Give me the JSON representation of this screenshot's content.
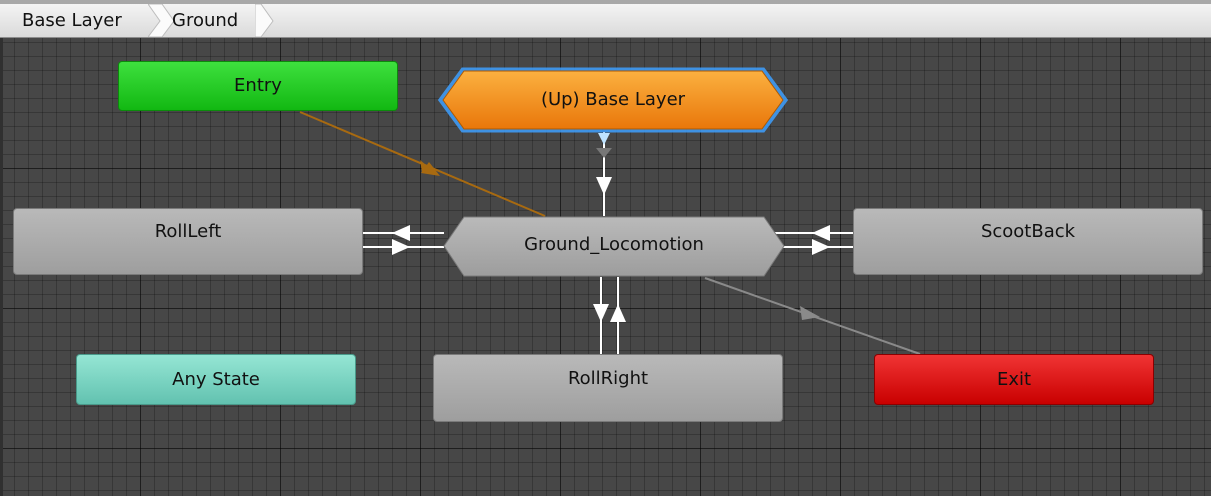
{
  "breadcrumb": {
    "items": [
      "Base Layer",
      "Ground"
    ]
  },
  "nodes": {
    "entry": "Entry",
    "up_base_layer": "(Up) Base Layer",
    "roll_left": "RollLeft",
    "ground_locomotion": "Ground_Locomotion",
    "scoot_back": "ScootBack",
    "any_state": "Any State",
    "roll_right": "RollRight",
    "exit": "Exit"
  },
  "colors": {
    "entry": "#22cc22",
    "up_base_layer": "#f08a10",
    "state": "#a8a8a8",
    "any_state": "#7ad6c4",
    "exit": "#e01010",
    "selection_glow": "#3ea0ff",
    "default_transition": "#a86a10"
  }
}
